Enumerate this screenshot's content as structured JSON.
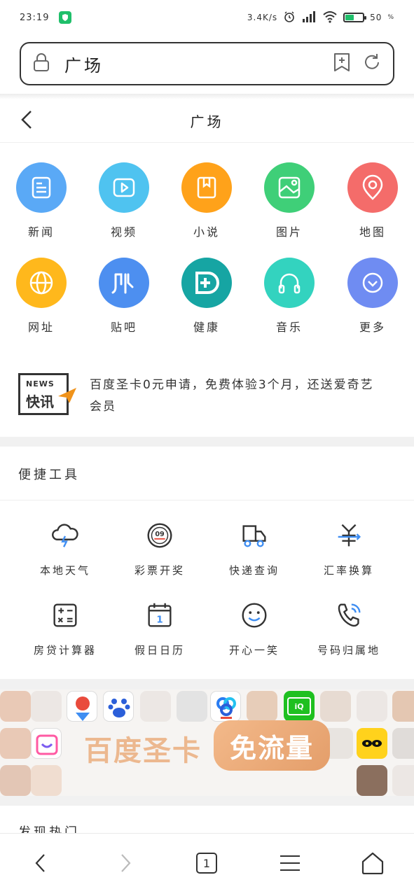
{
  "status_bar": {
    "time": "23:19",
    "net_speed": "3.4K/s",
    "battery_level": "50",
    "battery_fraction": 0.5
  },
  "address_bar": {
    "text": "广场"
  },
  "header": {
    "title": "广场"
  },
  "categories": [
    {
      "label": "新闻",
      "color": "#5aa9f6",
      "icon": "news-icon"
    },
    {
      "label": "视频",
      "color": "#4fc3f0",
      "icon": "video-icon"
    },
    {
      "label": "小说",
      "color": "#ffa21a",
      "icon": "novel-icon"
    },
    {
      "label": "图片",
      "color": "#3fcf78",
      "icon": "picture-icon"
    },
    {
      "label": "地图",
      "color": "#f46c6a",
      "icon": "map-icon"
    },
    {
      "label": "网址",
      "color": "#ffb81c",
      "icon": "globe-icon"
    },
    {
      "label": "贴吧",
      "color": "#4d8ff0",
      "icon": "tieba-icon"
    },
    {
      "label": "健康",
      "color": "#16a5a3",
      "icon": "health-icon"
    },
    {
      "label": "音乐",
      "color": "#33d3bf",
      "icon": "music-icon"
    },
    {
      "label": "更多",
      "color": "#6f8cf2",
      "icon": "more-icon"
    }
  ],
  "news": {
    "badge_en": "NEWS",
    "badge_cn": "快讯",
    "text": "百度圣卡0元申请，免费体验3个月，还送爱奇艺会员"
  },
  "tools": {
    "title": "便捷工具",
    "items": [
      {
        "label": "本地天气",
        "icon": "weather-icon"
      },
      {
        "label": "彩票开奖",
        "icon": "lottery-icon"
      },
      {
        "label": "快递查询",
        "icon": "delivery-icon"
      },
      {
        "label": "汇率换算",
        "icon": "exchange-icon"
      },
      {
        "label": "房贷计算器",
        "icon": "calculator-icon"
      },
      {
        "label": "假日日历",
        "icon": "calendar-icon"
      },
      {
        "label": "开心一笑",
        "icon": "smile-icon"
      },
      {
        "label": "号码归属地",
        "icon": "phone-icon"
      }
    ]
  },
  "banner": {
    "text_left": "百度圣卡",
    "text_right": "免流量"
  },
  "discover": {
    "title": "发现热门"
  },
  "bottom_nav": {
    "tab_count": "1"
  },
  "colors": {
    "accent_green": "#1fbf6a",
    "text": "#333333"
  }
}
